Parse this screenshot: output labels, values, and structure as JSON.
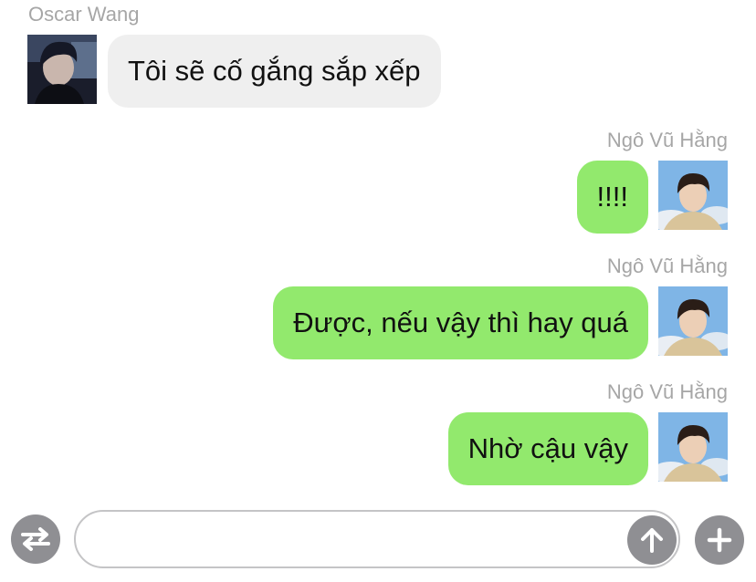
{
  "messages": [
    {
      "sender": "Oscar Wang",
      "text": "Tôi sẽ cố gắng sắp xếp",
      "direction": "incoming"
    },
    {
      "sender": "Ngô Vũ Hằng",
      "text": "!!!!",
      "direction": "outgoing"
    },
    {
      "sender": "Ngô Vũ Hằng",
      "text": "Được, nếu vậy thì hay quá",
      "direction": "outgoing"
    },
    {
      "sender": "Ngô Vũ Hằng",
      "text": "Nhờ cậu vậy",
      "direction": "outgoing"
    }
  ],
  "input": {
    "value": "",
    "placeholder": ""
  },
  "icons": {
    "switch": "switch-arrows-icon",
    "send": "arrow-up-icon",
    "add": "plus-icon"
  },
  "colors": {
    "incoming_bubble": "#efefef",
    "outgoing_bubble": "#92e96d",
    "sender_name": "#a6a6a6",
    "icon_button": "#8f8f93"
  }
}
